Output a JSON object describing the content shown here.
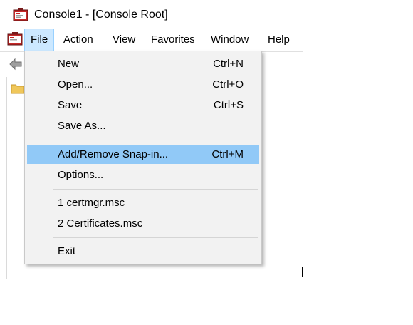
{
  "window": {
    "title": "Console1 - [Console Root]"
  },
  "icons": {
    "app": "mmc-console-icon",
    "menubar": "mmc-console-icon",
    "back": "back-arrow-icon",
    "folder": "folder-icon"
  },
  "menubar": {
    "items": [
      "File",
      "Action",
      "View",
      "Favorites",
      "Window",
      "Help"
    ],
    "active": "File"
  },
  "file_menu": {
    "items": [
      {
        "label": "New",
        "shortcut": "Ctrl+N"
      },
      {
        "label": "Open...",
        "shortcut": "Ctrl+O"
      },
      {
        "label": "Save",
        "shortcut": "Ctrl+S"
      },
      {
        "label": "Save As...",
        "shortcut": ""
      },
      {
        "label": "Add/Remove Snap-in...",
        "shortcut": "Ctrl+M",
        "highlighted": true
      },
      {
        "label": "Options...",
        "shortcut": ""
      },
      {
        "label": "1 certmgr.msc",
        "shortcut": ""
      },
      {
        "label": "2 Certificates.msc",
        "shortcut": ""
      },
      {
        "label": "Exit",
        "shortcut": ""
      }
    ]
  },
  "colors": {
    "menu_highlight": "#91c9f7",
    "menubar_active": "#cce8ff",
    "menu_background": "#f2f2f2"
  }
}
